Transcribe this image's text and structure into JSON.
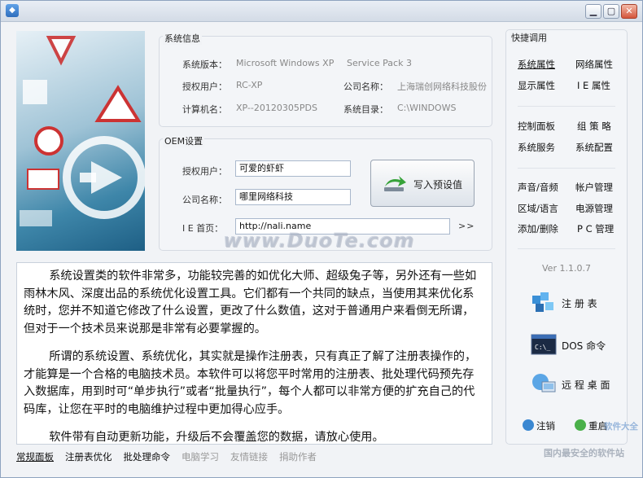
{
  "window": {
    "title": "",
    "buttons": [
      "▁",
      "▢",
      "✕"
    ]
  },
  "system_info": {
    "title": "系统信息",
    "version_label": "系统版本：",
    "version_value": "Microsoft Windows XP",
    "sp_value": "Service Pack 3",
    "user_label": "授权用户：",
    "user_value": "RC-XP",
    "company_label": "公司名称：",
    "company_value": "上海瑞创网络科技股份",
    "computer_label": "计算机名：",
    "computer_value": "XP--20120305PDS",
    "dir_label": "系统目录：",
    "dir_value": "C:\\WINDOWS"
  },
  "oem": {
    "title": "OEM设置",
    "user_label": "授权用户：",
    "user_value": "可爱的虾虾",
    "company_label": "公司名称：",
    "company_value": "哪里网络科技",
    "home_label": "I E 首页：",
    "home_value": "http://nali.name",
    "write_label": "写入预设值",
    "go_label": ">>"
  },
  "watermark": "www.DuoTe.com",
  "description": [
    "系统设置类的软件非常多，功能较完善的如优化大师、超级兔子等，另外还有一些如雨林木风、深度出品的系统优化设置工具。它们都有一个共同的缺点，当使用其来优化系统时，您并不知道它修改了什么设置，更改了什么数值，这对于普通用户来看倒无所谓，但对于一个技术员来说那是非常有必要掌握的。",
    "所谓的系统设置、系统优化，其实就是操作注册表，只有真正了解了注册表操作的，才能算是一个合格的电脑技术员。本软件可以将您平时常用的注册表、批处理代码预先存入数据库，用到时可“单步执行”或者“批量执行”，每个人都可以非常方便的扩充自己的代码库，让您在平时的电脑维护过程中更加得心应手。",
    "软件带有自动更新功能，升级后不会覆盖您的数据，请放心使用。"
  ],
  "tabs": [
    "常规面板",
    "注册表优化",
    "批处理命令",
    "电脑学习",
    "友情链接",
    "捐助作者"
  ],
  "quick": {
    "title": "快捷调用",
    "items": [
      "系统属性",
      "网络属性",
      "显示属性",
      "I E 属性",
      "控制面板",
      "组 策 略",
      "系统服务",
      "系统配置",
      "声音/音频",
      "帐户管理",
      "区域/语言",
      "电源管理",
      "添加/删除",
      "P C 管理"
    ],
    "version": "Ver 1.1.0.7",
    "regedit": "注 册 表",
    "dos": "DOS 命令",
    "remote": "远 程 桌 面",
    "logoff": "注销",
    "reboot": "重启",
    "brand1": "软件大全",
    "brand2": "国内最安全的软件站"
  }
}
